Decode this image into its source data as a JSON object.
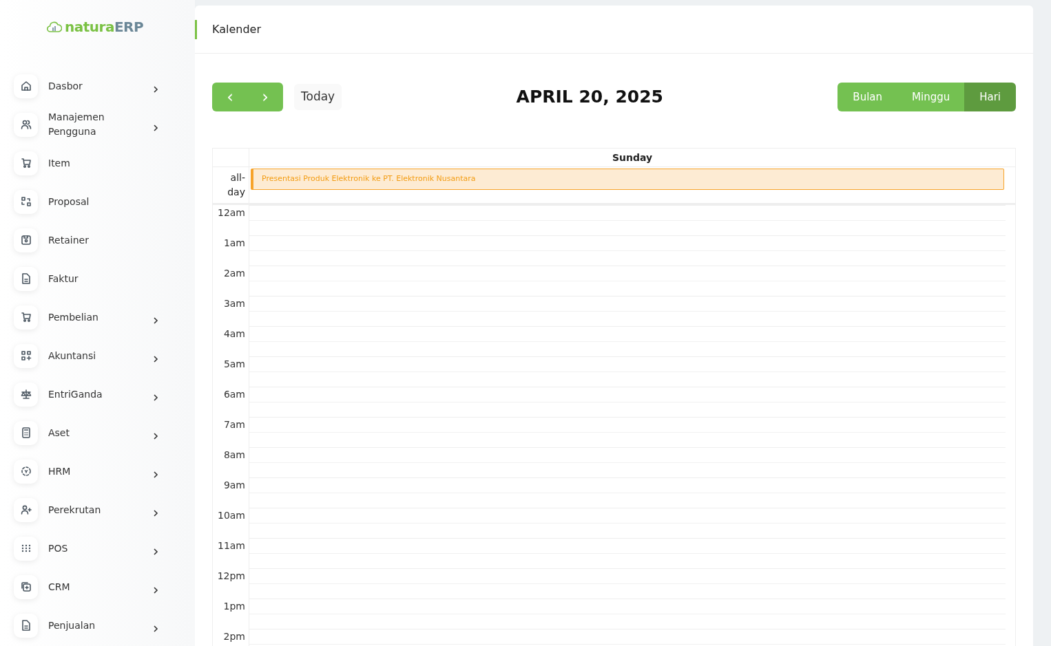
{
  "logo": {
    "primary": "natura",
    "secondary": "ERP"
  },
  "sidebar": {
    "items": [
      {
        "label": "Dasbor",
        "kind": "home",
        "has_submenu": true
      },
      {
        "label": "Manajemen Pengguna",
        "kind": "users",
        "has_submenu": true
      },
      {
        "label": "Item",
        "kind": "cart",
        "has_submenu": false
      },
      {
        "label": "Proposal",
        "kind": "swap",
        "has_submenu": false
      },
      {
        "label": "Retainer",
        "kind": "disk",
        "has_submenu": false
      },
      {
        "label": "Faktur",
        "kind": "file",
        "has_submenu": false
      },
      {
        "label": "Pembelian",
        "kind": "cart",
        "has_submenu": true
      },
      {
        "label": "Akuntansi",
        "kind": "gridplus",
        "has_submenu": true
      },
      {
        "label": "EntriGanda",
        "kind": "scale",
        "has_submenu": true
      },
      {
        "label": "Aset",
        "kind": "calculator",
        "has_submenu": true
      },
      {
        "label": "HRM",
        "kind": "dashed",
        "has_submenu": true
      },
      {
        "label": "Perekrutan",
        "kind": "userplus",
        "has_submenu": true
      },
      {
        "label": "POS",
        "kind": "dots",
        "has_submenu": true
      },
      {
        "label": "CRM",
        "kind": "copy",
        "has_submenu": true
      },
      {
        "label": "Penjualan",
        "kind": "file",
        "has_submenu": true
      }
    ]
  },
  "page": {
    "title": "Kalender"
  },
  "toolbar": {
    "prev": "‹",
    "next": "›",
    "today": "Today",
    "date": "APRIL 20, 2025",
    "views": [
      {
        "label": "Bulan",
        "selected": false
      },
      {
        "label": "Minggu",
        "selected": false
      },
      {
        "label": "Hari",
        "selected": true
      }
    ]
  },
  "calendar": {
    "day": "Sunday",
    "all_day_label": "all-day",
    "events": [
      {
        "title": "Presentasi Produk Elektronik ke PT. Elektronik Nusantara"
      }
    ],
    "slots": [
      "12am",
      "1am",
      "2am",
      "3am",
      "4am",
      "5am",
      "6am",
      "7am",
      "8am",
      "9am",
      "10am",
      "11am",
      "12pm",
      "1pm",
      "2pm"
    ]
  }
}
